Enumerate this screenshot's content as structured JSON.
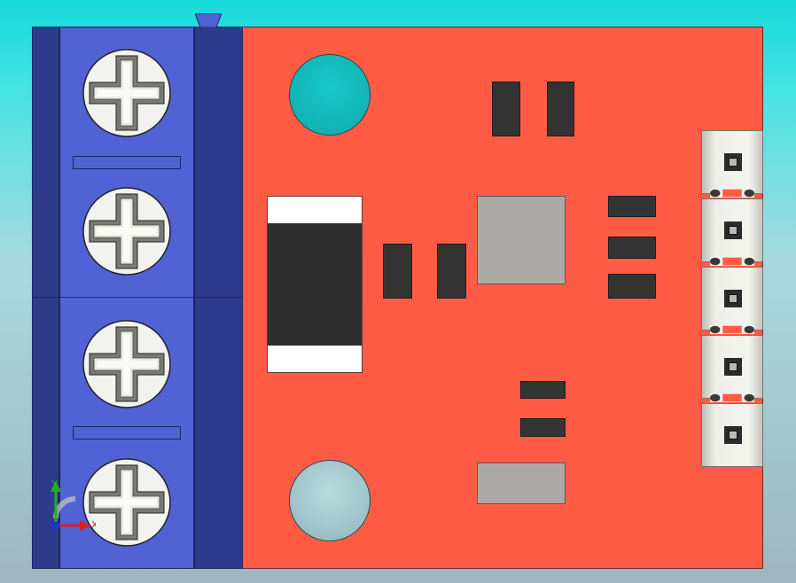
{
  "scene": {
    "description_colors": {
      "board": "#ff5b45",
      "terminal_block": "#5162d4",
      "terminal_dark": "#2e3a8c",
      "chip": "#333333",
      "ic_grey": "#aaa9a5",
      "header_white": "#f4f4ef",
      "mount_hole_top": "#0fbfbf",
      "mount_hole_bottom": "#9fc6cc"
    }
  },
  "axes": {
    "y_label": "Y",
    "x_label": "X"
  }
}
